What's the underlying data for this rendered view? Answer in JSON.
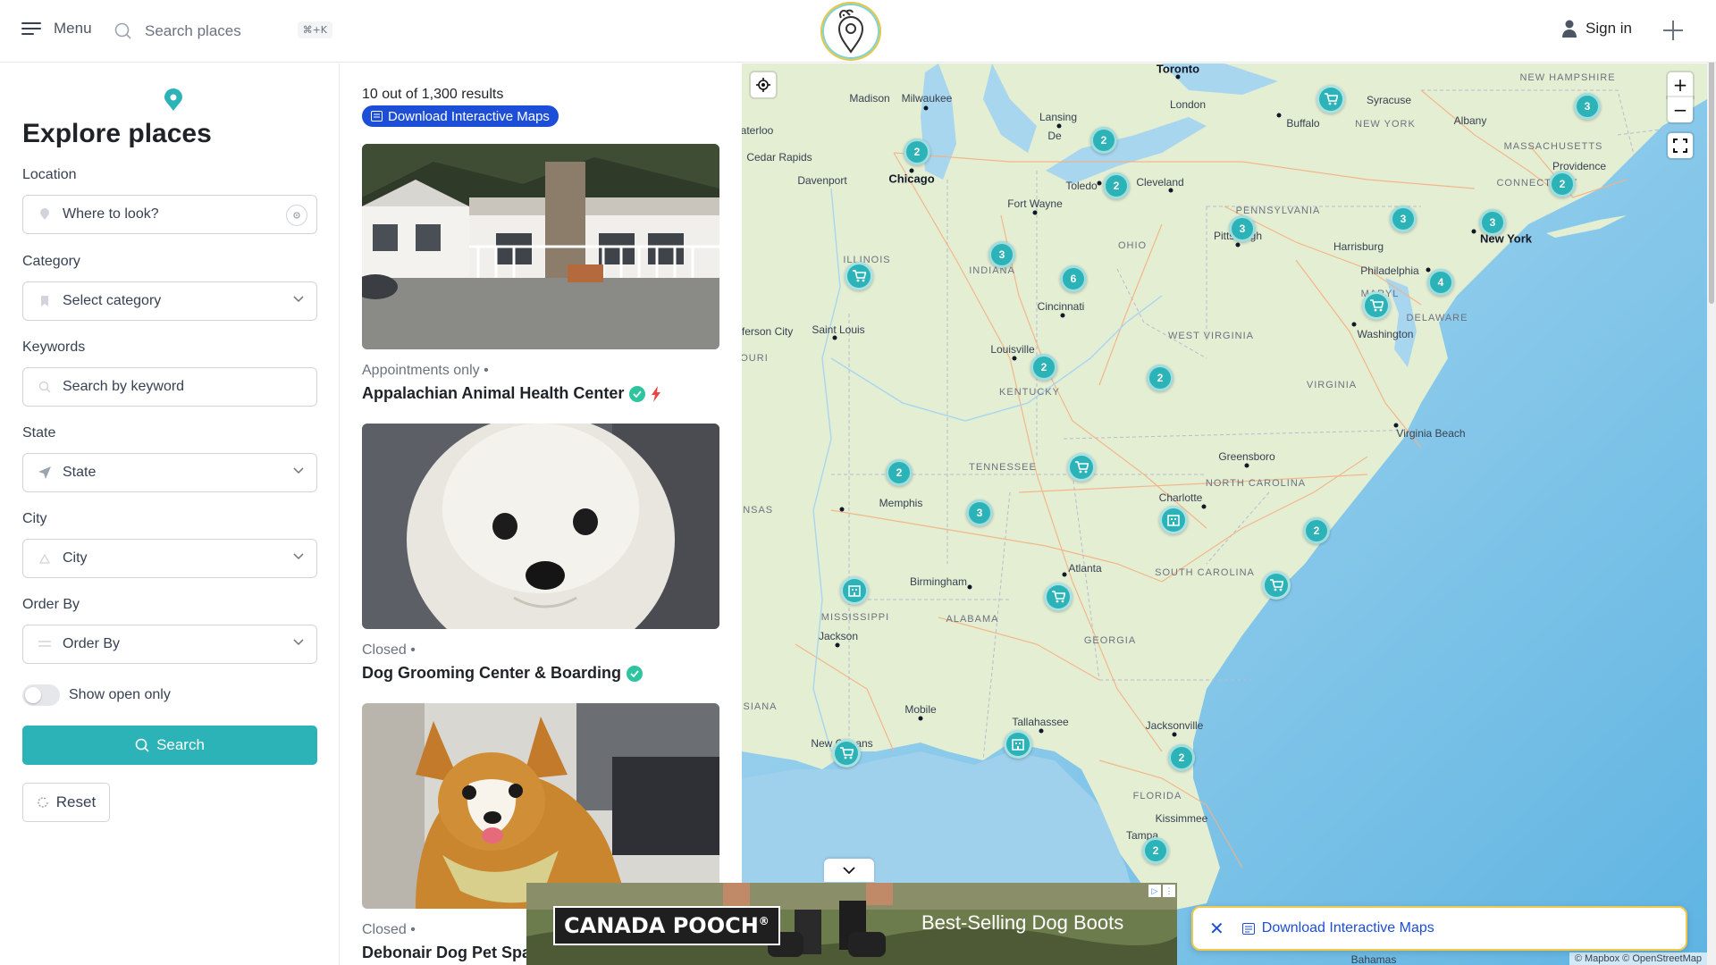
{
  "header": {
    "menu_label": "Menu",
    "search_placeholder": "Search places",
    "shortcut": "⌘+K",
    "signin_label": "Sign in"
  },
  "sidebar": {
    "title": "Explore places",
    "location_label": "Location",
    "location_placeholder": "Where to look?",
    "category_label": "Category",
    "category_value": "Select category",
    "keywords_label": "Keywords",
    "keywords_placeholder": "Search by keyword",
    "state_label": "State",
    "state_value": "State",
    "city_label": "City",
    "city_value": "City",
    "orderby_label": "Order By",
    "orderby_value": "Order By",
    "open_only_label": "Show open only",
    "open_only_checked": false,
    "search_button": "Search",
    "reset_button": "Reset"
  },
  "results": {
    "count_text": "10 out of 1,300 results",
    "download_label": "Download Interactive Maps",
    "items": [
      {
        "status": "Appointments only •",
        "title": "Appalachian Animal Health Center",
        "verified": true,
        "featured": true
      },
      {
        "status": "Closed •",
        "title": "Dog Grooming Center & Boarding",
        "verified": true,
        "featured": false
      },
      {
        "status": "Closed •",
        "title": "Debonair Dog Pet Spa",
        "verified": false,
        "featured": false
      }
    ]
  },
  "map": {
    "labels": {
      "toronto": "Toronto",
      "madison": "Madison",
      "milwaukee": "Milwaukee",
      "lansing": "Lansing",
      "london": "London",
      "syracuse": "Syracuse",
      "new_york_state": "NEW YORK",
      "albany": "Albany",
      "buffalo": "Buffalo",
      "new_hampshire": "NEW HAMPSHIRE",
      "massachusetts": "MASSACHUSETTS",
      "connecticut": "CONNECTICUT",
      "providence": "Providence",
      "waterloo": "aterloo",
      "cedar_rapids": "Cedar Rapids",
      "chicago": "Chicago",
      "davenport": "Davenport",
      "toledo": "Toledo",
      "cleveland": "Cleveland",
      "fort_wayne": "Fort Wayne",
      "pennsylvania": "PENNSYLVANIA",
      "pittsburgh": "Pittsburgh",
      "harrisburg": "Harrisburg",
      "new_york": "New York",
      "philadelphia": "Philadelphia",
      "illinois": "ILLINOIS",
      "indiana": "INDIANA",
      "ohio": "OHIO",
      "maryland": "MARYL",
      "delaware": "DELAWARE",
      "washington": "Washington",
      "jefferson_city": "fferson City",
      "saint_louis": "Saint Louis",
      "missouri": "OURI",
      "cincinnati": "Cincinnati",
      "west_virginia": "WEST VIRGINIA",
      "louisville": "Louisville",
      "virginia": "VIRGINIA",
      "kentucky": "KENTUCKY",
      "virginia_beach": "Virginia Beach",
      "greensboro": "Greensboro",
      "tennessee": "TENNESSEE",
      "north_carolina": "NORTH CAROLINA",
      "memphis": "Memphis",
      "arkansas": "ANSAS",
      "charlotte": "Charlotte",
      "atlanta": "Atlanta",
      "south_carolina": "SOUTH CAROLINA",
      "birmingham": "Birmingham",
      "mississippi": "MISSISSIPPI",
      "alabama": "ALABAMA",
      "georgia": "GEORGIA",
      "jackson": "Jackson",
      "mobile": "Mobile",
      "louisiana": "UISIANA",
      "tallahassee": "Tallahassee",
      "jacksonville": "Jacksonville",
      "new_orleans": "New Orleans",
      "florida": "FLORIDA",
      "kissimmee": "Kissimmee",
      "tampa": "Tampa",
      "bahamas": "Bahamas",
      "detroit": "De"
    },
    "clusters": [
      "3",
      "2",
      "2",
      "2",
      "3",
      "3",
      "3",
      "3",
      "2",
      "6",
      "4",
      "2",
      "2",
      "2",
      "3",
      "2",
      "2",
      "2"
    ],
    "markers": [
      "cart-icon",
      "cart-icon",
      "cart-icon",
      "cart-icon",
      "cart-icon",
      "cart-icon",
      "cart-icon",
      "building-icon",
      "building-icon",
      "building-icon"
    ],
    "attribution": "© Mapbox © OpenStreetMap",
    "zoom_in": "+",
    "zoom_out": "−"
  },
  "ad": {
    "brand": "CANADA POOCH",
    "brand_mark": "®",
    "tagline": "Best-Selling Dog Boots"
  },
  "toast": {
    "link_label": "Download Interactive Maps"
  },
  "colors": {
    "accent": "#2bb3b8",
    "link_blue": "#1d4ed8",
    "verified_green": "#2ec4a0",
    "featured_red": "#ef4444",
    "water": "#a8d6ef",
    "land": "#e7efd8"
  }
}
